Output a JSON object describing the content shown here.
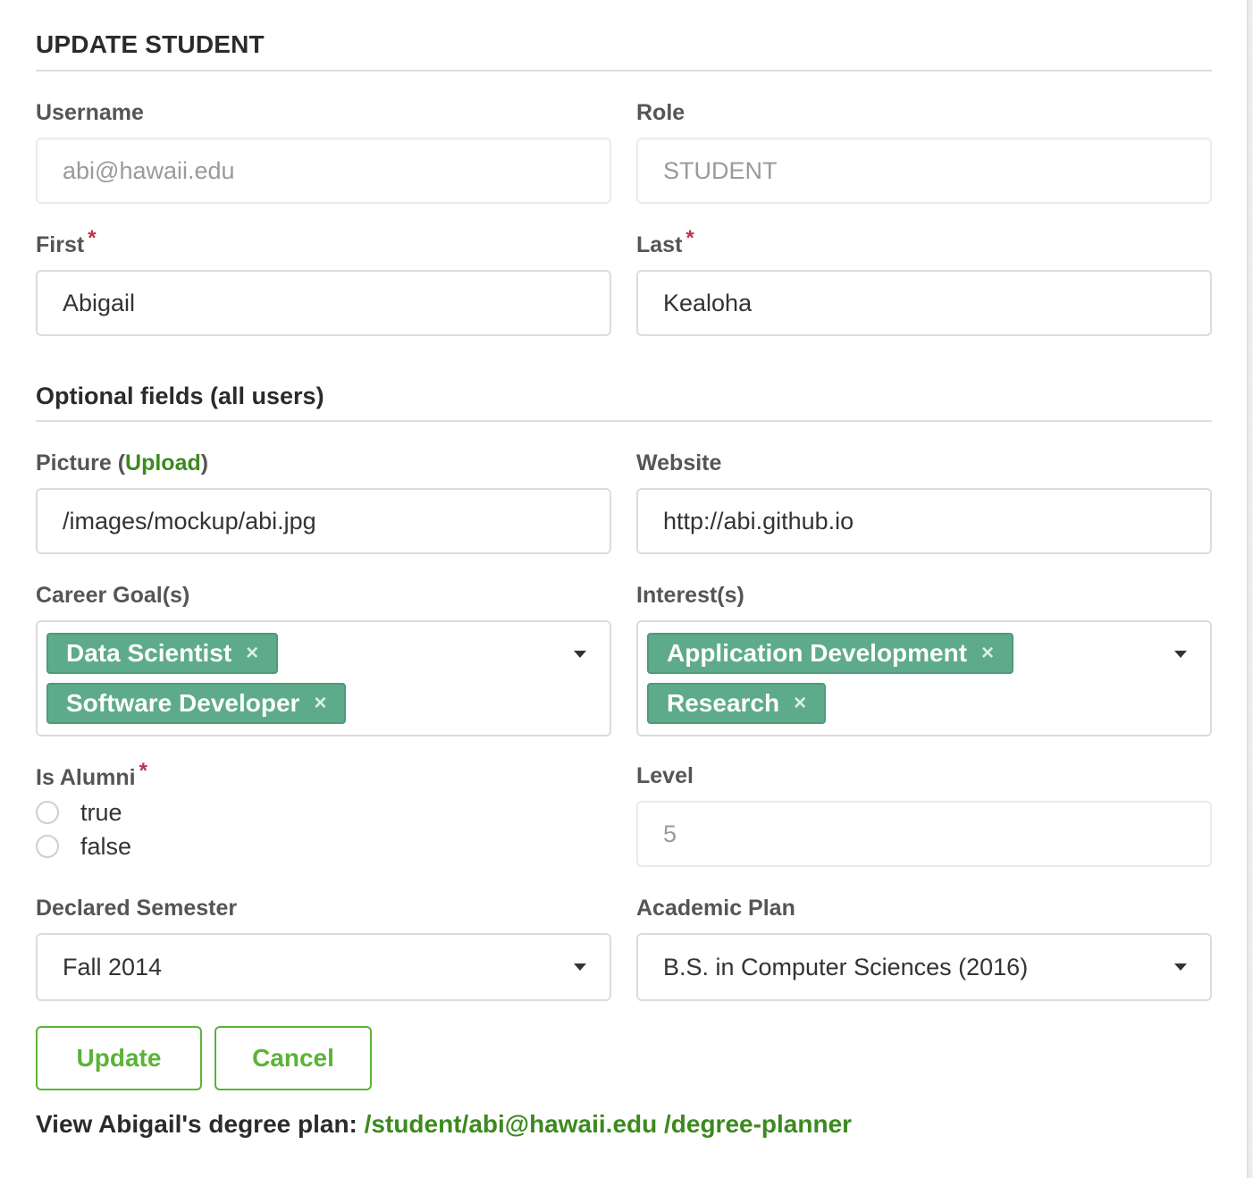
{
  "form": {
    "title": "UPDATE STUDENT",
    "username": {
      "label": "Username",
      "value": "abi@hawaii.edu"
    },
    "role": {
      "label": "Role",
      "value": "STUDENT"
    },
    "first": {
      "label": "First",
      "value": "Abigail",
      "required_mark": "*"
    },
    "last": {
      "label": "Last",
      "value": "Kealoha",
      "required_mark": "*"
    }
  },
  "optional": {
    "title": "Optional fields (all users)",
    "picture": {
      "label_prefix": "Picture (",
      "upload_link": "Upload",
      "label_suffix": ")",
      "value": "/images/mockup/abi.jpg"
    },
    "website": {
      "label": "Website",
      "value": "http://abi.github.io"
    },
    "career_goals": {
      "label": "Career Goal(s)",
      "chips": [
        "Data Scientist",
        "Software Developer"
      ]
    },
    "interests": {
      "label": "Interest(s)",
      "chips": [
        "Application Development",
        "Research"
      ]
    },
    "is_alumni": {
      "label": "Is Alumni",
      "required_mark": "*",
      "options": [
        "true",
        "false"
      ]
    },
    "level": {
      "label": "Level",
      "value": "5"
    },
    "declared_semester": {
      "label": "Declared Semester",
      "value": "Fall 2014"
    },
    "academic_plan": {
      "label": "Academic Plan",
      "value": "B.S. in Computer Sciences (2016)"
    }
  },
  "actions": {
    "update_label": "Update",
    "cancel_label": "Cancel"
  },
  "footer": {
    "prefix": "View Abigail's degree plan: ",
    "link": "/student/abi@hawaii.edu /degree-planner"
  },
  "icons": {
    "chip_remove": "×",
    "dropdown": "caret-down-icon"
  },
  "colors": {
    "accent_green": "#5bb337",
    "link_green": "#3c8a1e",
    "chip_teal": "#5dab8a",
    "required_red": "#c0304a"
  }
}
